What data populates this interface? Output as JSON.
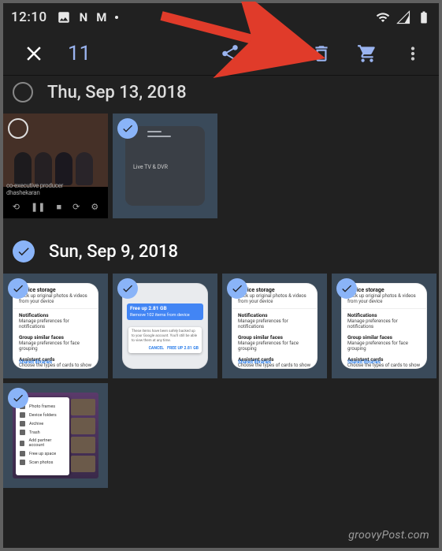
{
  "statusbar": {
    "time": "12:10",
    "left_icons": [
      "image-icon",
      "N",
      "M"
    ],
    "right_icons": [
      "wifi-icon",
      "signal-icon",
      "battery-icon"
    ]
  },
  "toolbar": {
    "close": "close",
    "count": "11",
    "share": "share",
    "add": "add",
    "delete": "delete",
    "cart": "cart",
    "more": "more"
  },
  "sections": [
    {
      "date": "Thu, Sep 13, 2018",
      "selected": "partial",
      "items": [
        {
          "type": "video",
          "selected": false,
          "caption": "co-executive producer",
          "name_line": "dhashekaran"
        },
        {
          "type": "settings",
          "selected": true,
          "chip": "Live TV & DVR"
        }
      ]
    },
    {
      "date": "Sun, Sep 9, 2018",
      "selected": "all",
      "items": [
        {
          "type": "settings-app",
          "selected": true,
          "head_title": "Device storage",
          "head_sub": "Back up original photos & videos from your device",
          "sec1_title": "Notifications",
          "sec1_sub": "Manage preferences for notifications",
          "sec2_title": "Group similar faces",
          "sec2_sub": "Manage preferences for face grouping",
          "sec3_title": "Assistant cards",
          "sec3_sub": "Choose the types of cards to show",
          "foot": "Shared libraries"
        },
        {
          "type": "settings-app-banner",
          "selected": true,
          "banner_title": "Free up 2.81 GB",
          "banner_sub": "Remove 102 items from device",
          "dialog_text": "These items have been safely backed up to your Google account. You'll still be able to view them at any time.",
          "dialog_cancel": "CANCEL",
          "dialog_ok": "FREE UP 2.81 GB"
        },
        {
          "type": "settings-app",
          "selected": true,
          "head_title": "Device storage",
          "head_sub": "Back up original photos & videos from your device",
          "sec1_title": "Notifications",
          "sec1_sub": "Manage preferences for notifications",
          "sec2_title": "Group similar faces",
          "sec2_sub": "Manage preferences for face grouping",
          "sec3_title": "Assistant cards",
          "sec3_sub": "Choose the types of cards to show",
          "foot": "Shared libraries"
        },
        {
          "type": "settings-app",
          "selected": true,
          "head_title": "Device storage",
          "head_sub": "Back up original photos & videos from your device",
          "sec1_title": "Notifications",
          "sec1_sub": "Manage preferences for notifications",
          "sec2_title": "Group similar faces",
          "sec2_sub": "Manage preferences for face grouping",
          "sec3_title": "Assistant cards",
          "sec3_sub": "Choose the types of cards to show",
          "foot": "Shared libraries"
        },
        {
          "type": "menu",
          "selected": true,
          "menu_title": "Photo frames",
          "menu_items": [
            "Device folders",
            "Archive",
            "Trash",
            "Add partner account",
            "Free up space",
            "Scan photos"
          ]
        }
      ]
    }
  ],
  "watermark": "groovyPost.com",
  "colors": {
    "accent": "#8ab4f8",
    "bg": "#212121"
  },
  "arrow": {
    "target": "delete-button"
  }
}
